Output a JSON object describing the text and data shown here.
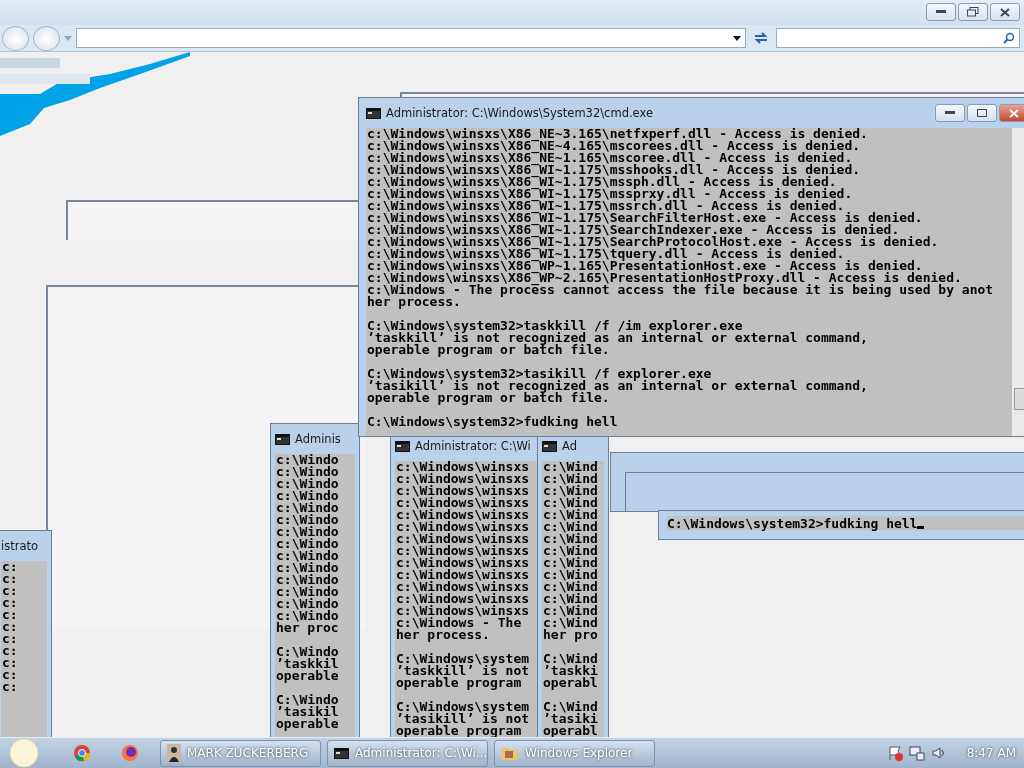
{
  "main_window": {
    "title": "Administrator: C:\\Windows\\System32\\cmd.exe",
    "blocks": [
      [
        "c:\\Windows\\winsxs\\X86_NE~3.165\\netfxperf.dll - Access is denied.",
        "c:\\Windows\\winsxs\\X86_NE~4.165\\mscorees.dll - Access is denied.",
        "c:\\Windows\\winsxs\\X86_NE~1.165\\mscoree.dll - Access is denied.",
        "c:\\Windows\\winsxs\\X86_WI~1.175\\msshooks.dll - Access is denied.",
        "c:\\Windows\\winsxs\\X86_WI~1.175\\mssph.dll - Access is denied.",
        "c:\\Windows\\winsxs\\X86_WI~1.175\\mssprxy.dll - Access is denied.",
        "c:\\Windows\\winsxs\\X86_WI~1.175\\mssrch.dll - Access is denied.",
        "c:\\Windows\\winsxs\\X86_WI~1.175\\SearchFilterHost.exe - Access is denied.",
        "c:\\Windows\\winsxs\\X86_WI~1.175\\SearchIndexer.exe - Access is denied.",
        "c:\\Windows\\winsxs\\X86_WI~1.175\\SearchProtocolHost.exe - Access is denied.",
        "c:\\Windows\\winsxs\\X86_WI~1.175\\tquery.dll - Access is denied.",
        "c:\\Windows\\winsxs\\X86_WP~1.165\\PresentationHost.exe - Access is denied.",
        "c:\\Windows\\winsxs\\X86_WP~2.165\\PresentationHostProxy.dll - Access is denied.",
        "c:\\Windows - The process cannot access the file because it is being used by anot",
        "her process."
      ],
      [
        "C:\\Windows\\system32>taskkill /f /im explorer.exe",
        "’taskkill’ is not recognized as an internal or external command,",
        "operable program or batch file."
      ],
      [
        "C:\\Windows\\system32>tasikill /f explorer.exe",
        "’tasikill’ is not recognized as an internal or external command,",
        "operable program or batch file."
      ],
      [
        "C:\\Windows\\system32>fudking hell"
      ]
    ]
  },
  "ghost_windows": [
    {
      "title": "Adminis",
      "blocks": [
        [
          "c:\\Windo",
          "c:\\Windo",
          "c:\\Windo",
          "c:\\Windo",
          "c:\\Windo",
          "c:\\Windo",
          "c:\\Windo",
          "c:\\Windo",
          "c:\\Windo",
          "c:\\Windo",
          "c:\\Windo",
          "c:\\Windo",
          "c:\\Windo",
          "c:\\Windo",
          "her proc"
        ],
        [
          "C:\\Windo",
          "’taskkil",
          "operable"
        ],
        [
          "C:\\Windo",
          "’tasikil",
          "operable"
        ]
      ]
    },
    {
      "title": "Administrator: C:\\Wi",
      "blocks": [
        [
          "c:\\Windows\\winsxs",
          "c:\\Windows\\winsxs",
          "c:\\Windows\\winsxs",
          "c:\\Windows\\winsxs",
          "c:\\Windows\\winsxs",
          "c:\\Windows\\winsxs",
          "c:\\Windows\\winsxs",
          "c:\\Windows\\winsxs",
          "c:\\Windows\\winsxs",
          "c:\\Windows\\winsxs",
          "c:\\Windows\\winsxs",
          "c:\\Windows\\winsxs",
          "c:\\Windows\\winsxs",
          "c:\\Windows - The",
          "her process."
        ],
        [
          "C:\\Windows\\system",
          "’taskkill’ is not",
          "operable program"
        ],
        [
          "C:\\Windows\\system",
          "’tasikill’ is not",
          "operable program"
        ]
      ]
    },
    {
      "title": "Ad",
      "blocks": [
        [
          "c:\\Wind",
          "c:\\Wind",
          "c:\\Wind",
          "c:\\Wind",
          "c:\\Wind",
          "c:\\Wind",
          "c:\\Wind",
          "c:\\Wind",
          "c:\\Wind",
          "c:\\Wind",
          "c:\\Wind",
          "c:\\Wind",
          "c:\\Wind",
          "c:\\Wind",
          "her pro"
        ],
        [
          "C:\\Wind",
          "’taskki",
          "operabl"
        ],
        [
          "C:\\Wind",
          "’tasiki",
          "operabl"
        ]
      ]
    },
    {
      "title": "istrato",
      "blocks": [
        [
          "c:",
          "c:",
          "c:",
          "c:",
          "c:",
          "c:",
          "c:",
          "c:",
          "c:",
          "c:",
          "c:"
        ]
      ]
    }
  ],
  "prompt_strip": {
    "text": "C:\\Windows\\system32>fudking hell"
  },
  "taskbar": {
    "tasks": [
      {
        "label": "MARK ZUCKERBERG",
        "kind": "photo"
      },
      {
        "label": "Administrator: C:\\Wi...",
        "kind": "console"
      },
      {
        "label": "Windows Explorer",
        "kind": "explorer"
      }
    ],
    "clock": "8:47 AM"
  }
}
